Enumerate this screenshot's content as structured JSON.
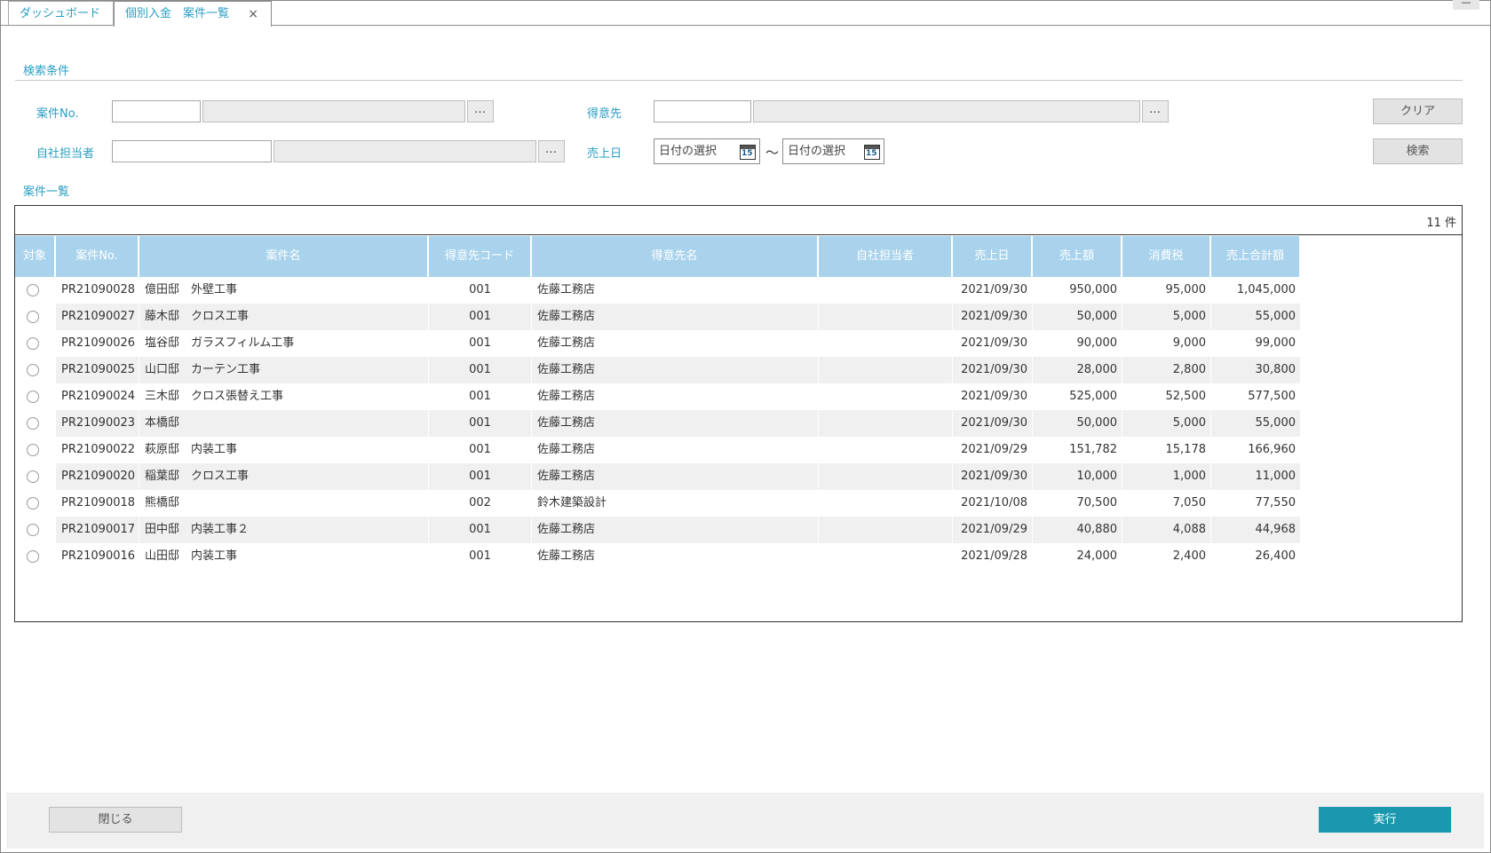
{
  "tabs": [
    {
      "label": "ダッシュボード"
    },
    {
      "label": "個別入金　案件一覧",
      "close": "×"
    }
  ],
  "window": {
    "minimize": "—"
  },
  "search": {
    "title": "検索条件",
    "case_no_label": "案件No.",
    "customer_label": "得意先",
    "staff_label": "自社担当者",
    "sales_date_label": "売上日",
    "browse": "…",
    "date_placeholder_from": "日付の選択",
    "date_placeholder_to": "日付の選択",
    "tilde": "〜",
    "calendar_day": "15",
    "clear_button": "クリア",
    "search_button": "検索"
  },
  "list": {
    "title": "案件一覧",
    "count": "11 件",
    "columns": [
      "対象",
      "案件No.",
      "案件名",
      "得意先コード",
      "得意先名",
      "自社担当者",
      "売上日",
      "売上額",
      "消費税",
      "売上合計額"
    ],
    "rows": [
      {
        "no": "PR21090028",
        "name": "億田邸　外壁工事",
        "code": "001",
        "customer": "佐藤工務店",
        "staff": "",
        "date": "2021/09/30",
        "sales": "950,000",
        "tax": "95,000",
        "total": "1,045,000"
      },
      {
        "no": "PR21090027",
        "name": "藤木邸　クロス工事",
        "code": "001",
        "customer": "佐藤工務店",
        "staff": "",
        "date": "2021/09/30",
        "sales": "50,000",
        "tax": "5,000",
        "total": "55,000"
      },
      {
        "no": "PR21090026",
        "name": "塩谷邸　ガラスフィルム工事",
        "code": "001",
        "customer": "佐藤工務店",
        "staff": "",
        "date": "2021/09/30",
        "sales": "90,000",
        "tax": "9,000",
        "total": "99,000"
      },
      {
        "no": "PR21090025",
        "name": "山口邸　カーテン工事",
        "code": "001",
        "customer": "佐藤工務店",
        "staff": "",
        "date": "2021/09/30",
        "sales": "28,000",
        "tax": "2,800",
        "total": "30,800"
      },
      {
        "no": "PR21090024",
        "name": "三木邸　クロス張替え工事",
        "code": "001",
        "customer": "佐藤工務店",
        "staff": "",
        "date": "2021/09/30",
        "sales": "525,000",
        "tax": "52,500",
        "total": "577,500"
      },
      {
        "no": "PR21090023",
        "name": "本橋邸",
        "code": "001",
        "customer": "佐藤工務店",
        "staff": "",
        "date": "2021/09/30",
        "sales": "50,000",
        "tax": "5,000",
        "total": "55,000"
      },
      {
        "no": "PR21090022",
        "name": "萩原邸　内装工事",
        "code": "001",
        "customer": "佐藤工務店",
        "staff": "",
        "date": "2021/09/29",
        "sales": "151,782",
        "tax": "15,178",
        "total": "166,960"
      },
      {
        "no": "PR21090020",
        "name": "稲葉邸　クロス工事",
        "code": "001",
        "customer": "佐藤工務店",
        "staff": "",
        "date": "2021/09/30",
        "sales": "10,000",
        "tax": "1,000",
        "total": "11,000"
      },
      {
        "no": "PR21090018",
        "name": "熊橋邸",
        "code": "002",
        "customer": "鈴木建築設計",
        "staff": "",
        "date": "2021/10/08",
        "sales": "70,500",
        "tax": "7,050",
        "total": "77,550"
      },
      {
        "no": "PR21090017",
        "name": "田中邸　内装工事２",
        "code": "001",
        "customer": "佐藤工務店",
        "staff": "",
        "date": "2021/09/29",
        "sales": "40,880",
        "tax": "4,088",
        "total": "44,968"
      },
      {
        "no": "PR21090016",
        "name": "山田邸　内装工事",
        "code": "001",
        "customer": "佐藤工務店",
        "staff": "",
        "date": "2021/09/28",
        "sales": "24,000",
        "tax": "2,400",
        "total": "26,400"
      }
    ]
  },
  "footer": {
    "close_button": "閉じる",
    "execute_button": "実行"
  },
  "colors": {
    "accent": "#2a9ec2",
    "header_bg": "#a9d3ec",
    "execute_bg": "#1b98b0",
    "alt_row": "#f0f0f0"
  }
}
